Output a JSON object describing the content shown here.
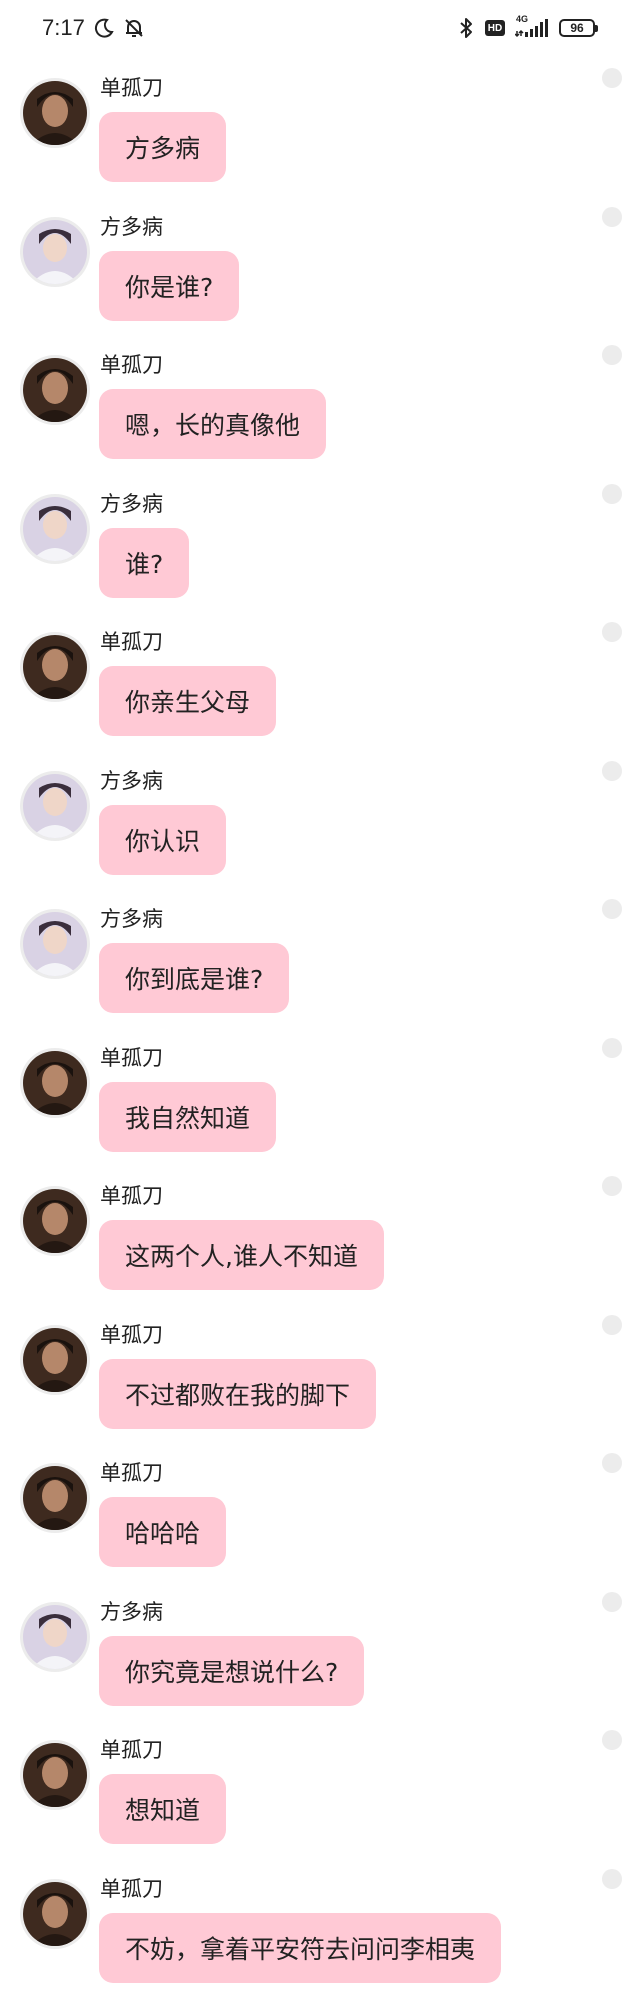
{
  "status_bar": {
    "time": "7:17",
    "hd": "HD",
    "network": "4G",
    "battery": "96",
    "icons": [
      "moon-icon",
      "bell-off-icon",
      "bluetooth-icon",
      "signal-icon"
    ]
  },
  "colors": {
    "bubble": "#ffc9d5",
    "background": "#ffffff",
    "avatar_ring": "#ececec"
  },
  "messages": [
    {
      "sender": "单孤刀",
      "text": "方多病"
    },
    {
      "sender": "方多病",
      "text": "你是谁?"
    },
    {
      "sender": "单孤刀",
      "text": "嗯，长的真像他"
    },
    {
      "sender": "方多病",
      "text": "谁?"
    },
    {
      "sender": "单孤刀",
      "text": "你亲生父母"
    },
    {
      "sender": "方多病",
      "text": "你认识"
    },
    {
      "sender": "方多病",
      "text": "你到底是谁?"
    },
    {
      "sender": "单孤刀",
      "text": "我自然知道"
    },
    {
      "sender": "单孤刀",
      "text": "这两个人,谁人不知道"
    },
    {
      "sender": "单孤刀",
      "text": "不过都败在我的脚下"
    },
    {
      "sender": "单孤刀",
      "text": "哈哈哈"
    },
    {
      "sender": "方多病",
      "text": "你究竟是想说什么?"
    },
    {
      "sender": "单孤刀",
      "text": "想知道"
    },
    {
      "sender": "单孤刀",
      "text": "不妨，拿着平安符去问问李相夷"
    }
  ]
}
